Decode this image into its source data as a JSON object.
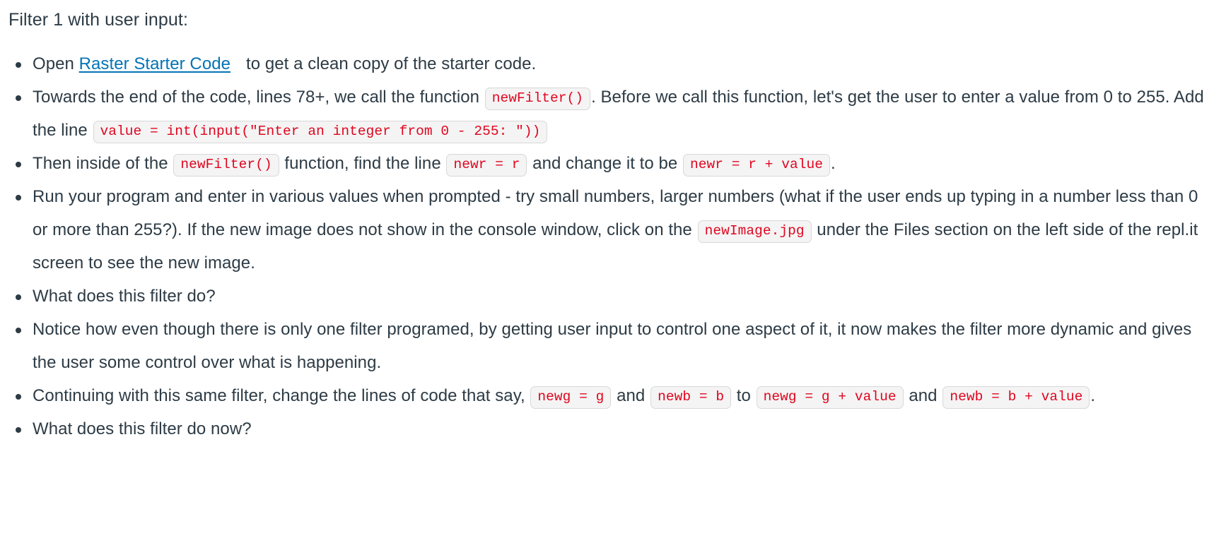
{
  "heading": "Filter 1 with user input:",
  "colors": {
    "text": "#2d3b45",
    "link": "#0374b5",
    "code_text": "#e0061f",
    "code_bg": "#f4f4f4",
    "code_border": "#d8d8d8",
    "background": "#ffffff"
  },
  "bullets": [
    {
      "id": "open-starter-code",
      "parts": {
        "t1": "Open ",
        "link": "Raster Starter Code",
        "t2": "to get a clean copy of the starter code."
      }
    },
    {
      "id": "add-input-line",
      "parts": {
        "t1": "Towards the end of the code, lines 78+, we call the function ",
        "c1": "newFilter()",
        "t2": ". Before we call this function, let's get the user to enter a value from 0 to 255. Add the line ",
        "c2": "value = int(input(\"Enter an integer from 0 - 255: \"))"
      }
    },
    {
      "id": "change-newr-line",
      "parts": {
        "t1": "Then inside of the ",
        "c1": "newFilter()",
        "t2": " function, find the line ",
        "c2": "newr = r",
        "t3": " and change it to be ",
        "c3": "newr = r + value",
        "t4": "."
      }
    },
    {
      "id": "run-and-test",
      "parts": {
        "t1": "Run your program and enter in various values when prompted - try small numbers, larger numbers (what if the user ends up typing in a number less than 0 or more than 255?). If the new image does not show in the console window, click on the ",
        "c1": "newImage.jpg",
        "t2": " under the Files section on the left side of the repl.it screen to see the new image."
      }
    },
    {
      "id": "what-does-filter-do",
      "parts": {
        "t1": "What does this filter do?"
      }
    },
    {
      "id": "dynamic-filter-note",
      "parts": {
        "t1": "Notice how even though there is only one filter programed, by getting user input to control one aspect of it, it now makes the filter more dynamic and gives the user some control over what is happening."
      }
    },
    {
      "id": "change-newg-newb",
      "parts": {
        "t1": "Continuing with this same filter, change the lines of code that say, ",
        "c1": "newg = g",
        "t2": " and ",
        "c2": "newb = b",
        "t3": " to ",
        "c3": "newg = g + value",
        "t4": " and ",
        "c4": "newb = b + value",
        "t5": "."
      }
    },
    {
      "id": "what-does-filter-do-now",
      "parts": {
        "t1": "What does this filter do now?"
      }
    }
  ]
}
